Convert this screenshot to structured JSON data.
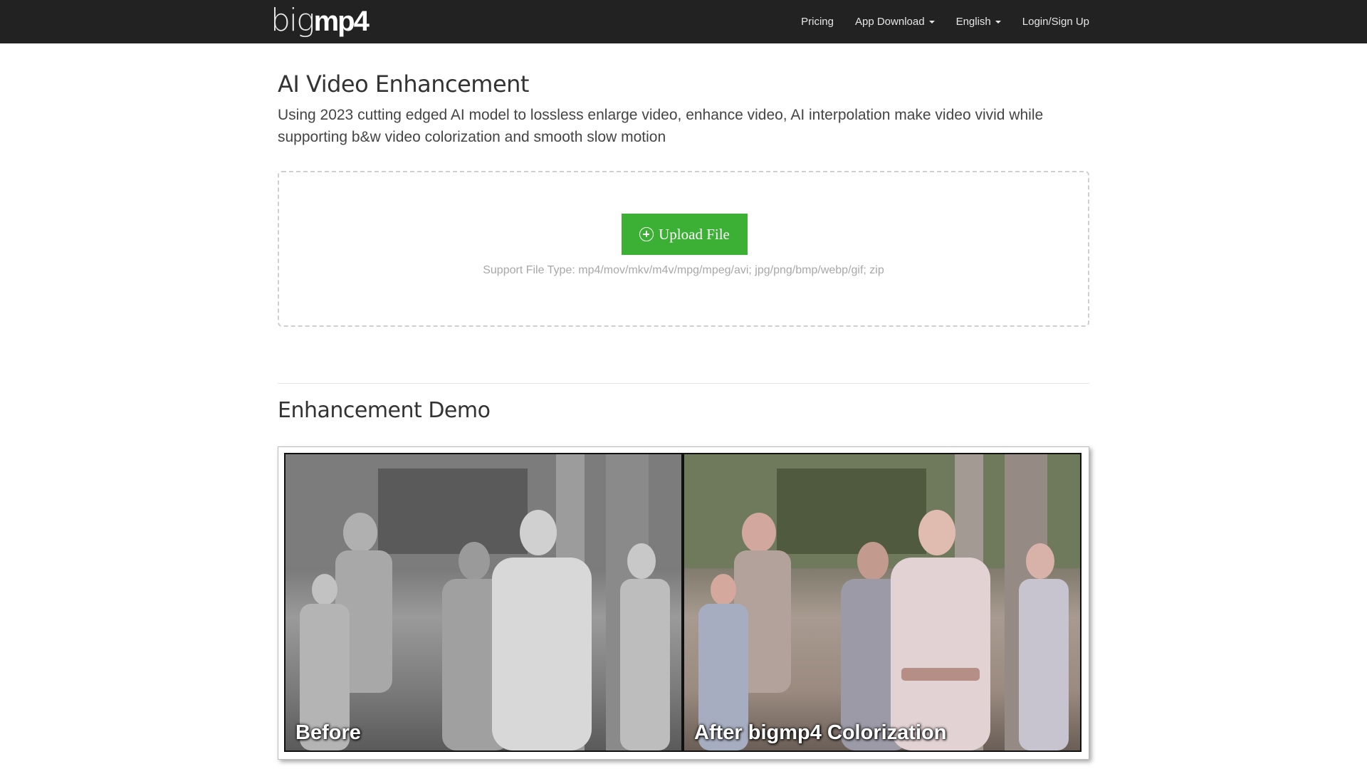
{
  "navbar": {
    "logo_light": "big",
    "logo_bold": "mp4",
    "items": [
      {
        "label": "Pricing",
        "dropdown": false
      },
      {
        "label": "App Download",
        "dropdown": true
      },
      {
        "label": "English",
        "dropdown": true
      },
      {
        "label": "Login/Sign Up",
        "dropdown": false
      }
    ]
  },
  "hero": {
    "title": "AI Video Enhancement",
    "description": "Using 2023 cutting edged AI model to lossless enlarge video, enhance video, AI interpolation make video vivid while supporting b&w video colorization and smooth slow motion"
  },
  "upload": {
    "button_label": "Upload File",
    "icon": "plus-circle-icon",
    "support_text": "Support File Type: mp4/mov/mkv/m4v/mpg/mpeg/avi; jpg/png/bmp/webp/gif; zip"
  },
  "demo": {
    "title": "Enhancement Demo",
    "before_label": "Before",
    "after_label": "After bigmp4 Colorization"
  },
  "colors": {
    "navbar_bg": "#222222",
    "upload_button": "#3cb034",
    "border_dashed": "#cfcfcf"
  }
}
